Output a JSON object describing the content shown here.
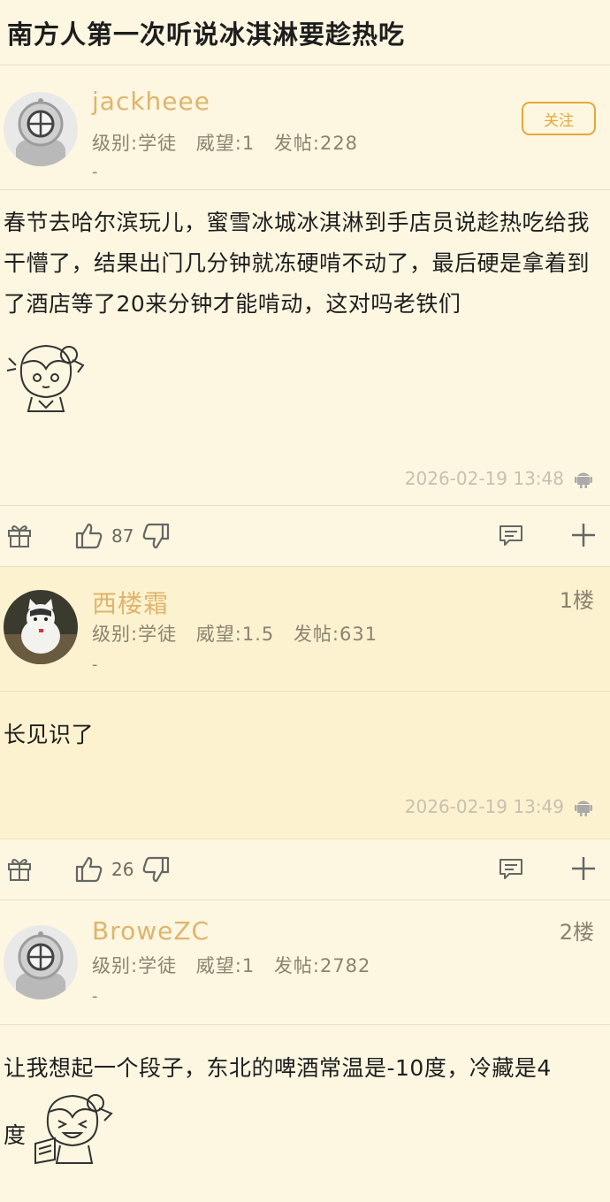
{
  "thread": {
    "title": "南方人第一次听说冰淇淋要趁热吃"
  },
  "op": {
    "username": "jackheee",
    "level": "级别:学徒",
    "prestige": "威望:1",
    "posts": "发帖:228",
    "signature": "-",
    "follow_label": "关注",
    "content": "春节去哈尔滨玩儿，蜜雪冰城冰淇淋到手店员说趁热吃给我干懵了，结果出门几分钟就冻硬啃不动了，最后硬是拿着到了酒店等了20来分钟才能啃动，这对吗老铁们",
    "time": "2026-02-19 13:48",
    "likes": "87",
    "avatar_icon": "diving-helmet-icon",
    "sticker_icon": "anime-girl-sticker-icon"
  },
  "replies": [
    {
      "username": "西楼霜",
      "floor": "1楼",
      "level": "级别:学徒",
      "prestige": "威望:1.5",
      "posts": "发帖:631",
      "signature": "-",
      "content": "长见识了",
      "time": "2026-02-19 13:49",
      "likes": "26",
      "avatar_icon": "cat-photo-avatar"
    },
    {
      "username": "BroweZC",
      "floor": "2楼",
      "level": "级别:学徒",
      "prestige": "威望:1",
      "posts": "发帖:2782",
      "signature": "-",
      "content_line1": "让我想起一个段子，东北的啤酒常温是-10度，冷藏是4",
      "content_line2": "度",
      "avatar_icon": "diving-helmet-icon",
      "sticker_icon": "anime-girl-laughing-sticker-icon"
    }
  ],
  "colors": {
    "background": "#fdf7e1",
    "reply_background": "#fdf2d0",
    "username": "#e0b46c",
    "follow": "#e4a83c",
    "meta": "#8a8370"
  }
}
